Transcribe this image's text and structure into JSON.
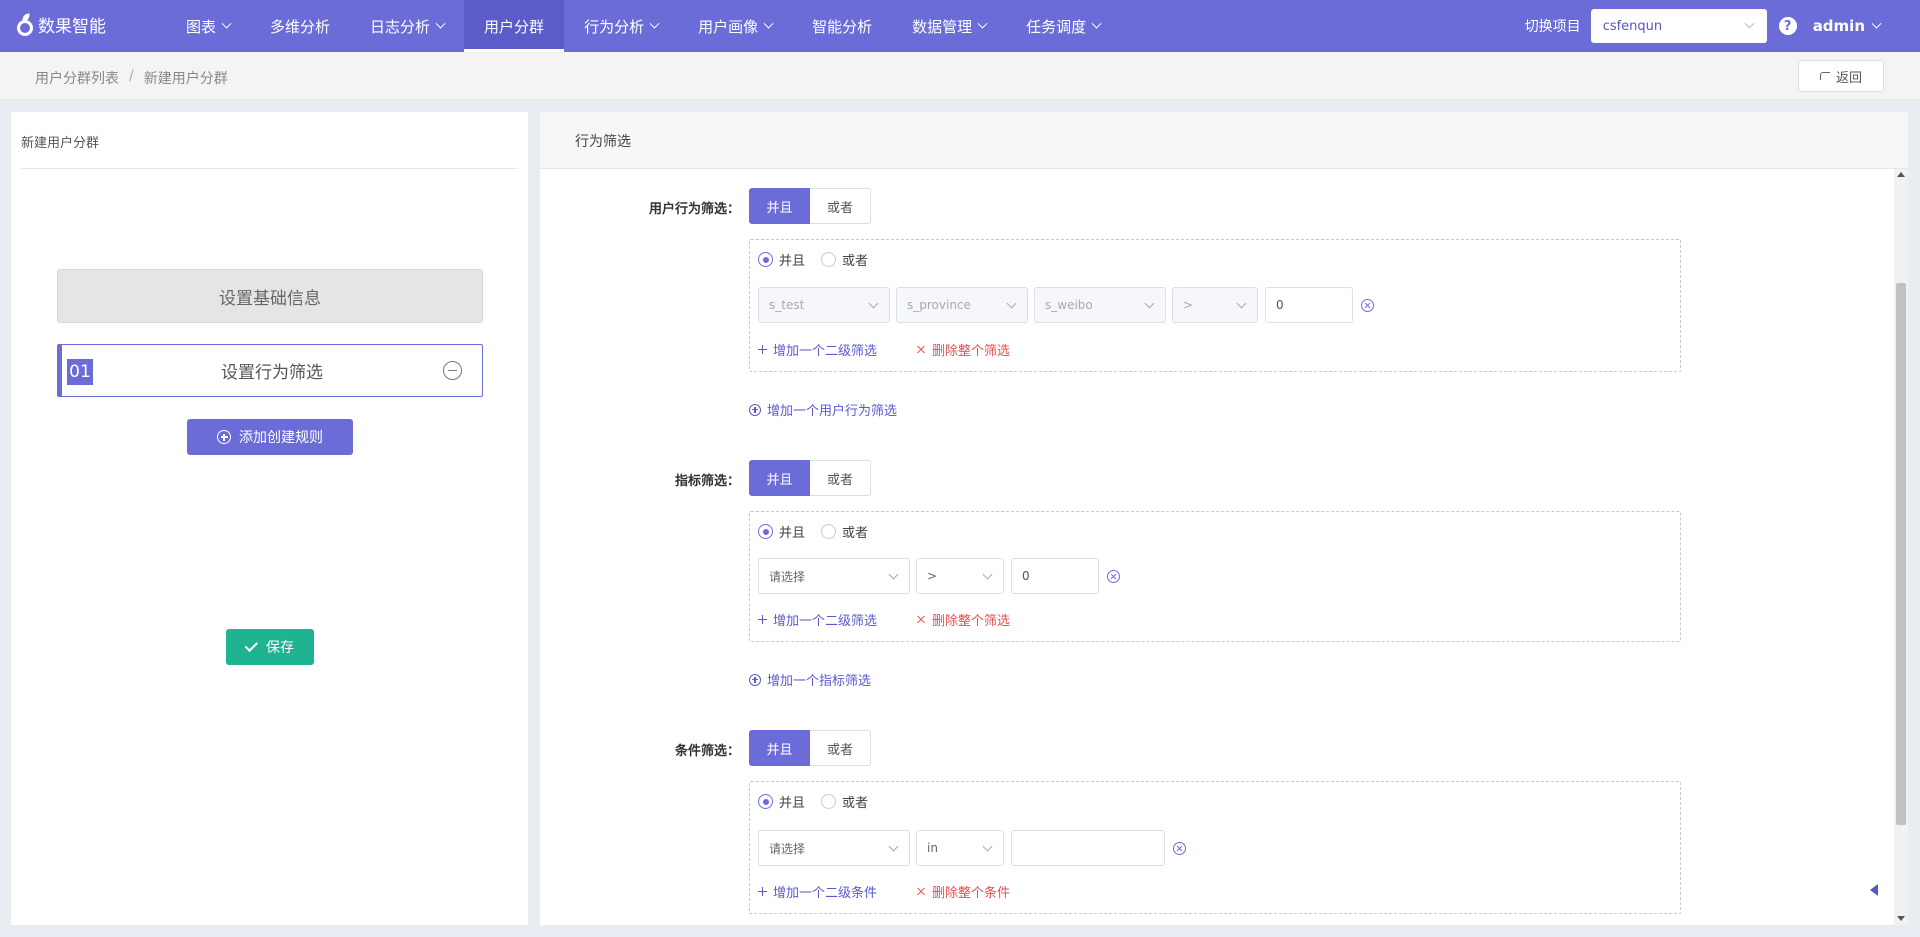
{
  "app": {
    "logo_text": "数果智能"
  },
  "nav": {
    "items": [
      {
        "label": "图表",
        "dropdown": true
      },
      {
        "label": "多维分析",
        "dropdown": false
      },
      {
        "label": "日志分析",
        "dropdown": true
      },
      {
        "label": "用户分群",
        "dropdown": false,
        "active": true
      },
      {
        "label": "行为分析",
        "dropdown": true
      },
      {
        "label": "用户画像",
        "dropdown": true
      },
      {
        "label": "智能分析",
        "dropdown": false
      },
      {
        "label": "数据管理",
        "dropdown": true
      },
      {
        "label": "任务调度",
        "dropdown": true
      }
    ],
    "switch_label": "切换项目",
    "project": "csfenqun",
    "help": "?",
    "user": "admin"
  },
  "breadcrumb": {
    "parent": "用户分群列表",
    "sep": "/",
    "current": "新建用户分群"
  },
  "back_label": "返回",
  "left": {
    "title": "新建用户分群",
    "step_basic": "设置基础信息",
    "step_num": "01",
    "step_rule": "设置行为筛选",
    "add_rule": "添加创建规则",
    "save": "保存"
  },
  "right": {
    "title": "行为筛选",
    "and_label": "并且",
    "or_label": "或者",
    "behavior": {
      "label": "用户行为筛选：",
      "selects": [
        "s_test",
        "s_province",
        "s_weibo",
        ">"
      ],
      "value": "0",
      "add_second": "增加一个二级筛选",
      "delete_all": "删除整个筛选",
      "add_more": "增加一个用户行为筛选"
    },
    "metric": {
      "label": "指标筛选：",
      "selects": [
        "请选择",
        ">"
      ],
      "value": "0",
      "add_second": "增加一个二级筛选",
      "delete_all": "删除整个筛选",
      "add_more": "增加一个指标筛选"
    },
    "condition": {
      "label": "条件筛选：",
      "selects": [
        "请选择",
        "in"
      ],
      "value": "",
      "add_second": "增加一个二级条件",
      "delete_all": "删除整个条件"
    }
  },
  "colors": {
    "primary": "#6c6cd9",
    "save": "#20b391",
    "danger": "#e05252"
  }
}
